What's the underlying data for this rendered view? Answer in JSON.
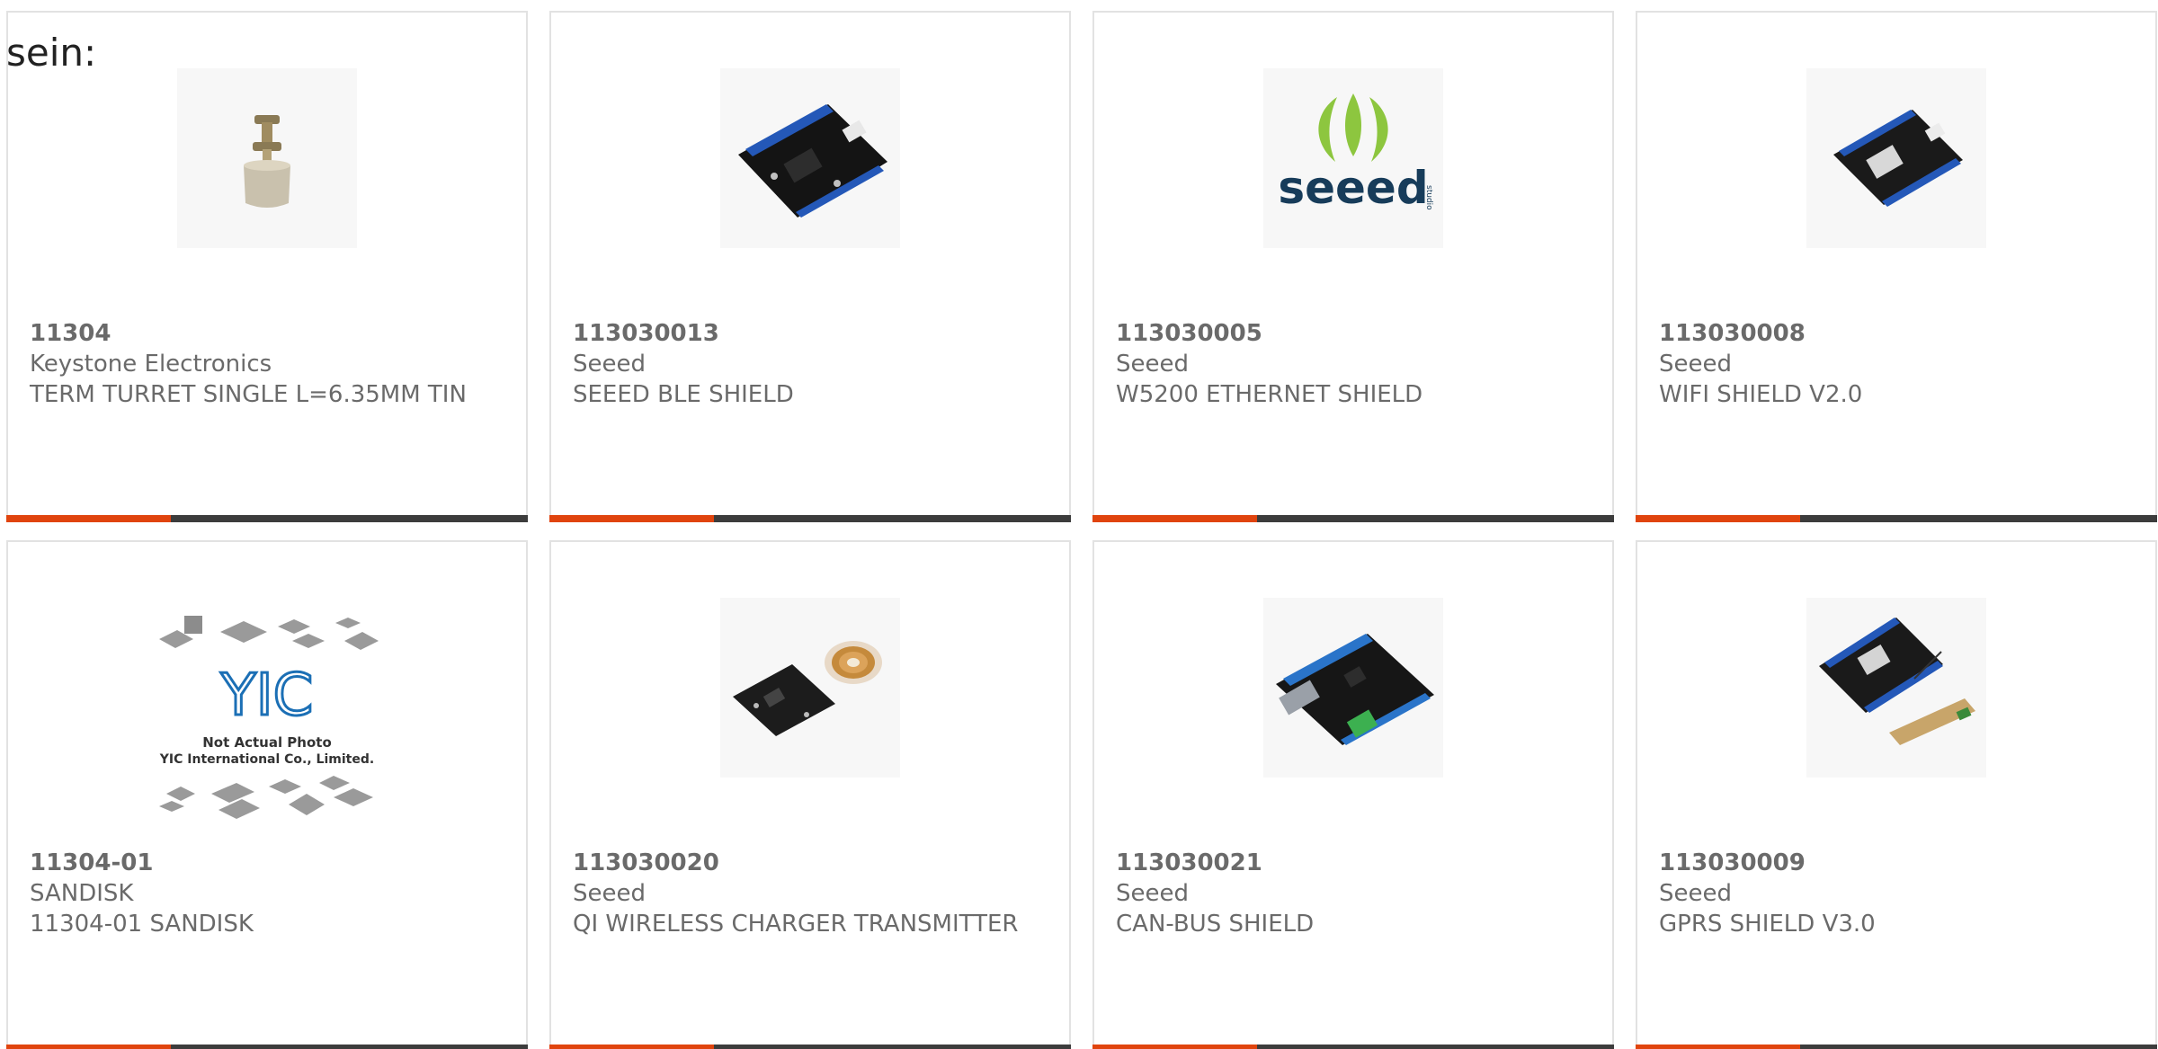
{
  "leading_text": "sein:",
  "products": [
    {
      "part_number": "11304",
      "manufacturer": "Keystone Electronics",
      "description": "TERM TURRET SINGLE L=6.35MM TIN",
      "image": "turret-terminal-image"
    },
    {
      "part_number": "113030013",
      "manufacturer": "Seeed",
      "description": "SEEED BLE SHIELD",
      "image": "ble-shield-board-image"
    },
    {
      "part_number": "113030005",
      "manufacturer": "Seeed",
      "description": "W5200 ETHERNET SHIELD",
      "image": "seeed-studio-logo",
      "logo_text": "seeed",
      "logo_subtext": "studio"
    },
    {
      "part_number": "113030008",
      "manufacturer": "Seeed",
      "description": "WIFI SHIELD V2.0",
      "image": "wifi-shield-board-image"
    },
    {
      "part_number": "11304-01",
      "manufacturer": "SANDISK",
      "description": "11304-01 SANDISK",
      "image": "yic-placeholder-image",
      "placeholder_logo": "YIC",
      "placeholder_line1": "Not Actual Photo",
      "placeholder_line2": "YIC International Co., Limited."
    },
    {
      "part_number": "113030020",
      "manufacturer": "Seeed",
      "description": "QI WIRELESS CHARGER TRANSMITTER",
      "image": "qi-charger-board-image"
    },
    {
      "part_number": "113030021",
      "manufacturer": "Seeed",
      "description": "CAN-BUS SHIELD",
      "image": "can-bus-shield-board-image"
    },
    {
      "part_number": "113030009",
      "manufacturer": "Seeed",
      "description": "GPRS SHIELD V3.0",
      "image": "gprs-shield-board-image"
    }
  ],
  "colors": {
    "accent": "#e0440e",
    "bar": "#3c3c3c",
    "text": "#6a6a6a",
    "card_border": "#e2e2e2",
    "seeed_green": "#8dc63f",
    "seeed_navy": "#173c5a",
    "yic_blue": "#1b6fb5"
  },
  "bar_accent_fraction": 0.315
}
